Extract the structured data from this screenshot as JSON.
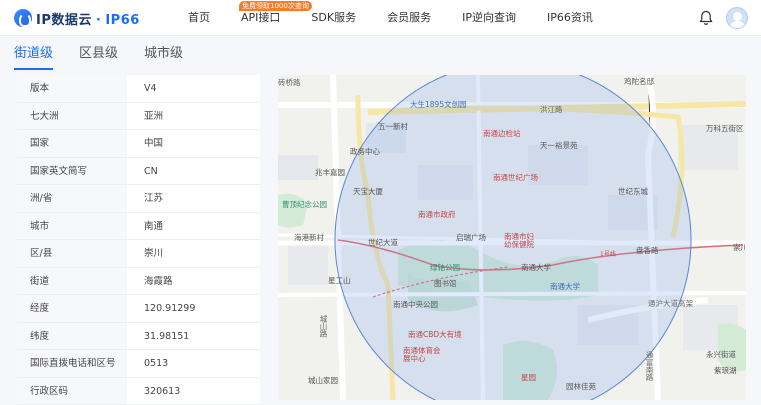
{
  "header": {
    "logo_prefix": "IP数据云",
    "logo_dot": "·",
    "logo_brand": "IP66",
    "promo_badge": "免费领取1000次查询",
    "nav": [
      "首页",
      "API接口",
      "SDK服务",
      "会员服务",
      "IP逆向查询",
      "IP66资讯"
    ]
  },
  "tabs": [
    "街道级",
    "区县级",
    "城市级"
  ],
  "active_tab": "街道级",
  "info": [
    {
      "key": "版本",
      "value": "V4"
    },
    {
      "key": "七大洲",
      "value": "亚洲"
    },
    {
      "key": "国家",
      "value": "中国"
    },
    {
      "key": "国家英文简写",
      "value": "CN"
    },
    {
      "key": "洲/省",
      "value": "江苏"
    },
    {
      "key": "城市",
      "value": "南通"
    },
    {
      "key": "区/县",
      "value": "崇川"
    },
    {
      "key": "街道",
      "value": "海霞路"
    },
    {
      "key": "经度",
      "value": "120.91299"
    },
    {
      "key": "纬度",
      "value": "31.98151"
    },
    {
      "key": "国际直拨电话和区号",
      "value": "0513"
    },
    {
      "key": "行政区码",
      "value": "320613"
    }
  ],
  "map": {
    "labels": [
      {
        "text": "砖桥路",
        "cls": "road"
      },
      {
        "text": "大生1895文创园",
        "cls": "blue"
      },
      {
        "text": "洪江路",
        "cls": "road"
      },
      {
        "text": "鸡陀名邸",
        "cls": ""
      },
      {
        "text": "五一新村",
        "cls": ""
      },
      {
        "text": "南通边检站",
        "cls": "red"
      },
      {
        "text": "万科五街区",
        "cls": ""
      },
      {
        "text": "政务中心",
        "cls": ""
      },
      {
        "text": "天一裕景苑",
        "cls": ""
      },
      {
        "text": "兆丰嘉园",
        "cls": ""
      },
      {
        "text": "南通世纪广场",
        "cls": "red"
      },
      {
        "text": "天宝大厦",
        "cls": ""
      },
      {
        "text": "世纪东城",
        "cls": ""
      },
      {
        "text": "曹顶纪念公园",
        "cls": "teal"
      },
      {
        "text": "南通市政府",
        "cls": "red"
      },
      {
        "text": "海港新村",
        "cls": ""
      },
      {
        "text": "世纪大道",
        "cls": ""
      },
      {
        "text": "启瑞广场",
        "cls": ""
      },
      {
        "text": "南通市妇幼保健院",
        "cls": "red"
      },
      {
        "text": "盘香路",
        "cls": ""
      },
      {
        "text": "崇川",
        "cls": ""
      },
      {
        "text": "1号线",
        "cls": "red"
      },
      {
        "text": "绿轴公园",
        "cls": "teal"
      },
      {
        "text": "南通大学",
        "cls": ""
      },
      {
        "text": "星工山",
        "cls": ""
      },
      {
        "text": "图书馆",
        "cls": ""
      },
      {
        "text": "南通大学",
        "cls": "blue"
      },
      {
        "text": "南通中央公园",
        "cls": ""
      },
      {
        "text": "通沪大道高架",
        "cls": "road"
      },
      {
        "text": "城山路",
        "cls": "road"
      },
      {
        "text": "南通CBD大有境",
        "cls": "red"
      },
      {
        "text": "南通体育会展中心",
        "cls": "red"
      },
      {
        "text": "永兴街道",
        "cls": ""
      },
      {
        "text": "通富南路",
        "cls": "road"
      },
      {
        "text": "城山家园",
        "cls": ""
      },
      {
        "text": "星园",
        "cls": "red"
      },
      {
        "text": "园林佳苑",
        "cls": ""
      },
      {
        "text": "紫琅湖",
        "cls": ""
      }
    ]
  }
}
